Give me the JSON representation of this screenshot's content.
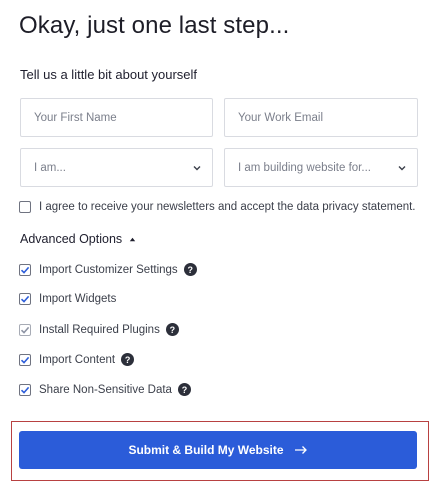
{
  "header": {
    "title": "Okay, just one last step...",
    "subtitle": "Tell us a little bit about yourself"
  },
  "form": {
    "first_name_placeholder": "Your First Name",
    "work_email_placeholder": "Your Work Email",
    "role_select": {
      "selected": "I am..."
    },
    "purpose_select": {
      "selected": "I am building website for..."
    },
    "newsletter": {
      "label": "I agree to receive your newsletters and accept the data privacy statement.",
      "checked": false
    }
  },
  "advanced": {
    "title": "Advanced Options",
    "expanded": true,
    "options": [
      {
        "label": "Import Customizer Settings",
        "checked": true,
        "help": true
      },
      {
        "label": "Import Widgets",
        "checked": true,
        "help": false
      },
      {
        "label": "Install Required Plugins",
        "checked": true,
        "disabled": true,
        "help": true
      },
      {
        "label": "Import Content",
        "checked": true,
        "help": true
      },
      {
        "label": "Share Non-Sensitive Data",
        "checked": true,
        "help": true
      }
    ]
  },
  "submit": {
    "label": "Submit & Build My Website"
  },
  "colors": {
    "accent": "#2b5cd9",
    "highlight_border": "#b84141",
    "checkbox_check": "#2b5cd9"
  },
  "icons": {
    "help": "question-mark-icon",
    "select": "chevron-down-icon",
    "advanced_toggle": "caret-up-icon",
    "submit": "arrow-right-icon"
  }
}
